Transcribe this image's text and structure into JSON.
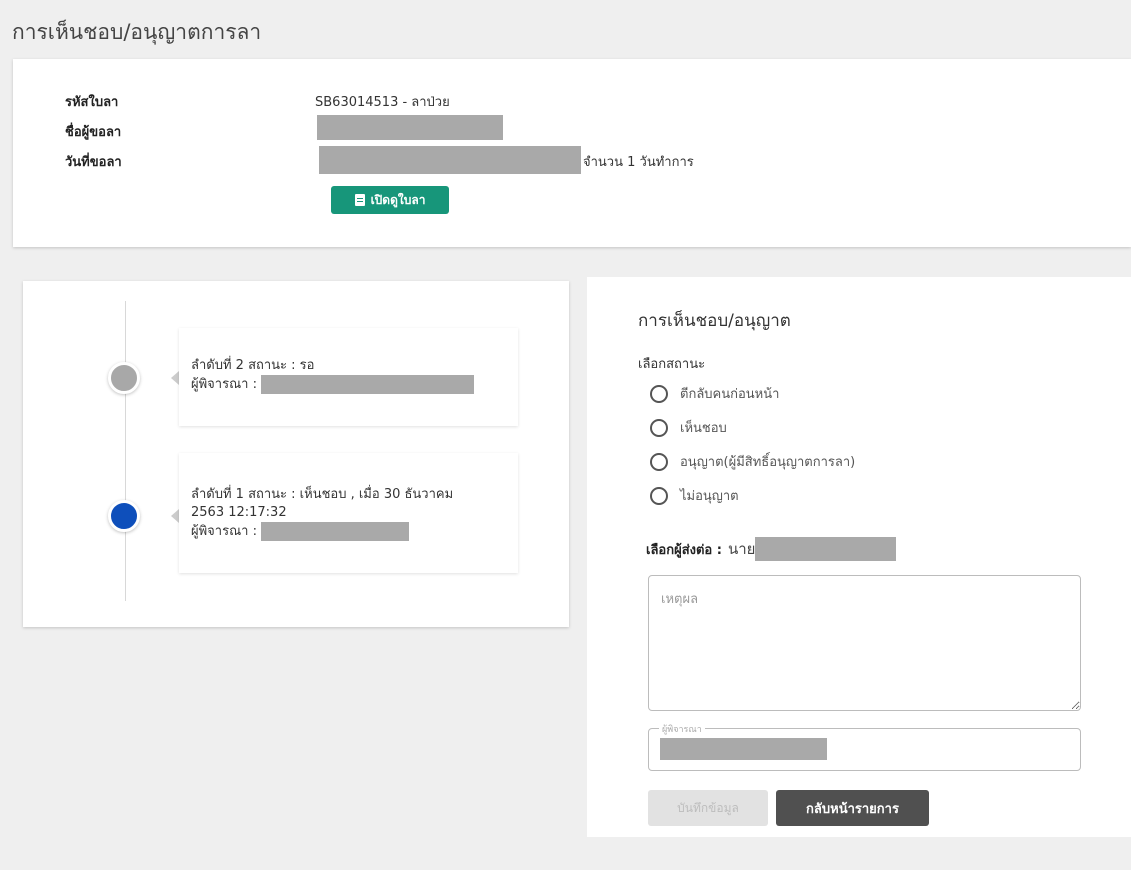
{
  "page": {
    "title": "การเห็นชอบ/อนุญาตการลา"
  },
  "leave_info": {
    "code_label": "รหัสใบลา",
    "code_value": "SB63014513 - ลาป่วย",
    "requester_label": "ชื่อผู้ขอลา",
    "date_label": "วันที่ขอลา",
    "date_suffix": "จำนวน 1 วันทำการ",
    "open_button": "เปิดดูใบลา"
  },
  "timeline": {
    "items": [
      {
        "line1": "ลำดับที่ 2 สถานะ : รอ",
        "line2": "",
        "approver_label": "ผู้พิจารณา :",
        "dot_color": "#a8a8a8"
      },
      {
        "line1": "ลำดับที่ 1 สถานะ : เห็นชอบ , เมื่อ 30 ธันวาคม",
        "line2": "2563 12:17:32",
        "approver_label": "ผู้พิจารณา :",
        "dot_color": "#0e4fbb"
      }
    ]
  },
  "approval_form": {
    "title": "การเห็นชอบ/อนุญาต",
    "status_label": "เลือกสถานะ",
    "options": [
      "ตีกลับคนก่อนหน้า",
      "เห็นชอบ",
      "อนุญาต(ผู้มีสิทธิ์อนุญาตการลา)",
      "ไม่อนุญาต"
    ],
    "forward_label": "เลือกผู้ส่งต่อ :",
    "forward_prefix": "นาย",
    "reason_placeholder": "เหตุผล",
    "approver_legend": "ผู้พิจารณา",
    "save_button": "บันทึกข้อมูล",
    "back_button": "กลับหน้ารายการ"
  },
  "colors": {
    "accent_green": "#17967a",
    "dark_button": "#505050",
    "timeline_active": "#0e4fbb",
    "timeline_pending": "#a8a8a8"
  },
  "icons": {
    "open_button_icon": "document-icon"
  }
}
